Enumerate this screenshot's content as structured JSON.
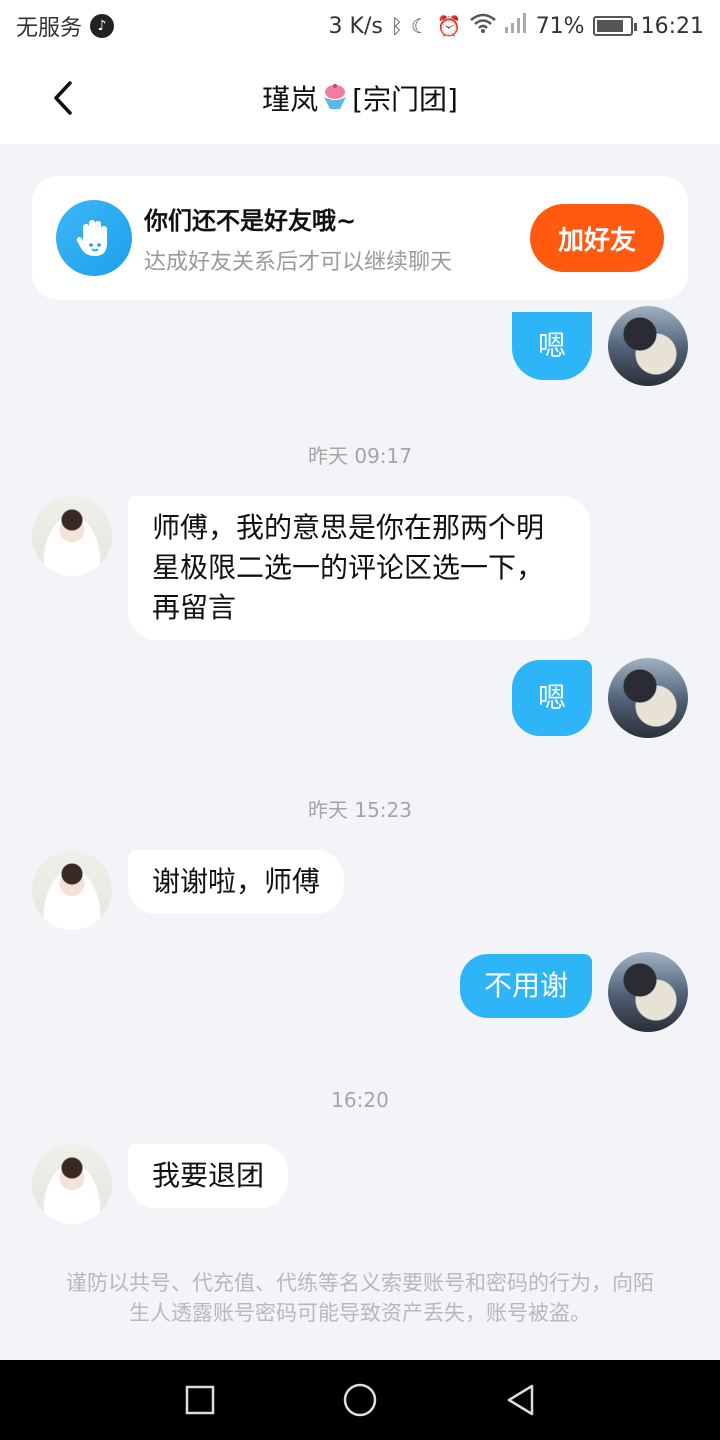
{
  "status_bar": {
    "carrier": "无服务",
    "speed": "3 K/s",
    "battery": "71%",
    "time": "16:21",
    "icons": [
      "tiktok-icon",
      "bluetooth-icon",
      "moon-icon",
      "alarm-icon",
      "wifi-icon",
      "signal-icon",
      "battery-icon"
    ]
  },
  "header": {
    "title_name": "瑾岚",
    "title_suffix": "[宗门团]",
    "title_icon": "icecream-icon",
    "back_icon": "chevron-left-icon"
  },
  "friend_prompt": {
    "title": "你们还不是好友哦~",
    "subtitle": "达成好友关系后才可以继续聊天",
    "button": "加好友",
    "button_color": "#ff5a10"
  },
  "messages": {
    "m0": {
      "direction": "out",
      "text": "嗯"
    },
    "ts1": "昨天 09:17",
    "m1": {
      "direction": "in",
      "text": "师傅，我的意思是你在那两个明星极限二选一的评论区选一下，再留言"
    },
    "m2": {
      "direction": "out",
      "text": "嗯"
    },
    "ts2": "昨天 15:23",
    "m3": {
      "direction": "in",
      "text": "谢谢啦，师傅"
    },
    "m4": {
      "direction": "out",
      "text": "不用谢"
    },
    "ts3": "16:20",
    "m5": {
      "direction": "in",
      "text": "我要退团"
    }
  },
  "notice": "谨防以共号、代充值、代练等名义索要账号和密码的行为，向陌生人透露账号密码可能导致资产丢失，账号被盗。",
  "colors": {
    "outgoing_bubble": "#2db5f7",
    "incoming_bubble": "#ffffff",
    "chat_background": "#f3f4f8"
  }
}
